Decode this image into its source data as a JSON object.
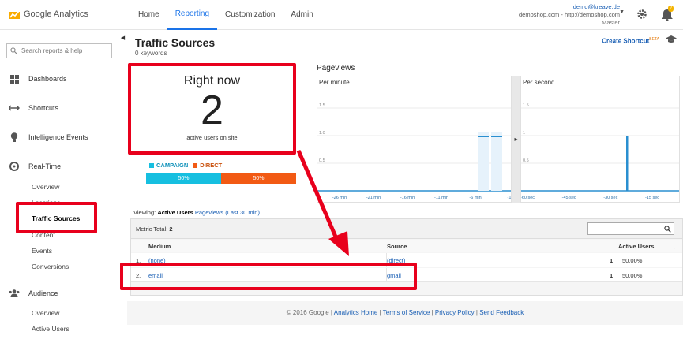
{
  "app": {
    "name": "Google Analytics"
  },
  "nav": {
    "items": [
      {
        "label": "Home"
      },
      {
        "label": "Reporting"
      },
      {
        "label": "Customization"
      },
      {
        "label": "Admin"
      }
    ]
  },
  "account": {
    "email": "demo@kreave.de",
    "site": "demoshop.com - http://demoshop.com",
    "view": "Master",
    "notifications": "2"
  },
  "sidebar": {
    "search_placeholder": "Search reports & help",
    "sections": {
      "dashboards": "Dashboards",
      "shortcuts": "Shortcuts",
      "intelligence": "Intelligence Events",
      "realtime": "Real-Time",
      "audience": "Audience"
    },
    "realtime_items": {
      "overview": "Overview",
      "locations": "Locations",
      "traffic_sources": "Traffic Sources",
      "content": "Content",
      "events": "Events",
      "conversions": "Conversions"
    },
    "audience_items": {
      "overview": "Overview",
      "active_users": "Active Users"
    }
  },
  "page": {
    "title": "Traffic Sources",
    "subtitle": "0 keywords",
    "shortcut_label": "Create Shortcut",
    "shortcut_badge": "BETA"
  },
  "right_now": {
    "title": "Right now",
    "count": "2",
    "label": "active users on site"
  },
  "split": {
    "legend_campaign": "CAMPAIGN",
    "legend_direct": "DIRECT",
    "campaign_pct": "50%",
    "direct_pct": "50%",
    "campaign_share": 0.5,
    "colors": {
      "campaign": "#16bfe0",
      "direct": "#f25a14"
    }
  },
  "pageviews": {
    "title": "Pageviews",
    "per_minute_label": "Per minute",
    "per_second_label": "Per second",
    "y_ticks": [
      "1.5",
      "1.0",
      "0.5"
    ],
    "y_ticks_right": [
      "1.5",
      "1",
      "0.5"
    ],
    "x_ticks_minute": [
      "-26 min",
      "-21 min",
      "-16 min",
      "-11 min",
      "-6 min",
      "-1"
    ],
    "x_ticks_second": [
      "-60 sec",
      "-45 sec",
      "-30 sec",
      "-15 sec"
    ]
  },
  "chart_data": [
    {
      "type": "bar",
      "title": "Per minute",
      "categories": [
        "-2 min",
        "-1 min"
      ],
      "values": [
        1,
        1
      ],
      "ylim": [
        0,
        1.5
      ]
    },
    {
      "type": "bar",
      "title": "Per second",
      "categories": [
        "-27 sec"
      ],
      "values": [
        1
      ],
      "ylim": [
        0,
        1.5
      ]
    }
  ],
  "viewing": {
    "label": "Viewing:",
    "active": "Active Users",
    "other": "Pageviews (Last 30 min)"
  },
  "table": {
    "metric_total_label": "Metric Total:",
    "metric_total": "2",
    "headers": {
      "medium": "Medium",
      "source": "Source",
      "active_users": "Active Users"
    },
    "rows": [
      {
        "num": "1.",
        "medium": "(none)",
        "source": "(direct)",
        "users": "1",
        "pct": "50.00%"
      },
      {
        "num": "2.",
        "medium": "email",
        "source": "gmail",
        "users": "1",
        "pct": "50.00%"
      }
    ]
  },
  "footer": {
    "copyright": "© 2016 Google |",
    "links": [
      "Analytics Home",
      "Terms of Service",
      "Privacy Policy",
      "Send Feedback"
    ]
  },
  "colors": {
    "highlight": "#e8001c",
    "accent": "#1a73e8",
    "bar": "#2a8fd0"
  }
}
